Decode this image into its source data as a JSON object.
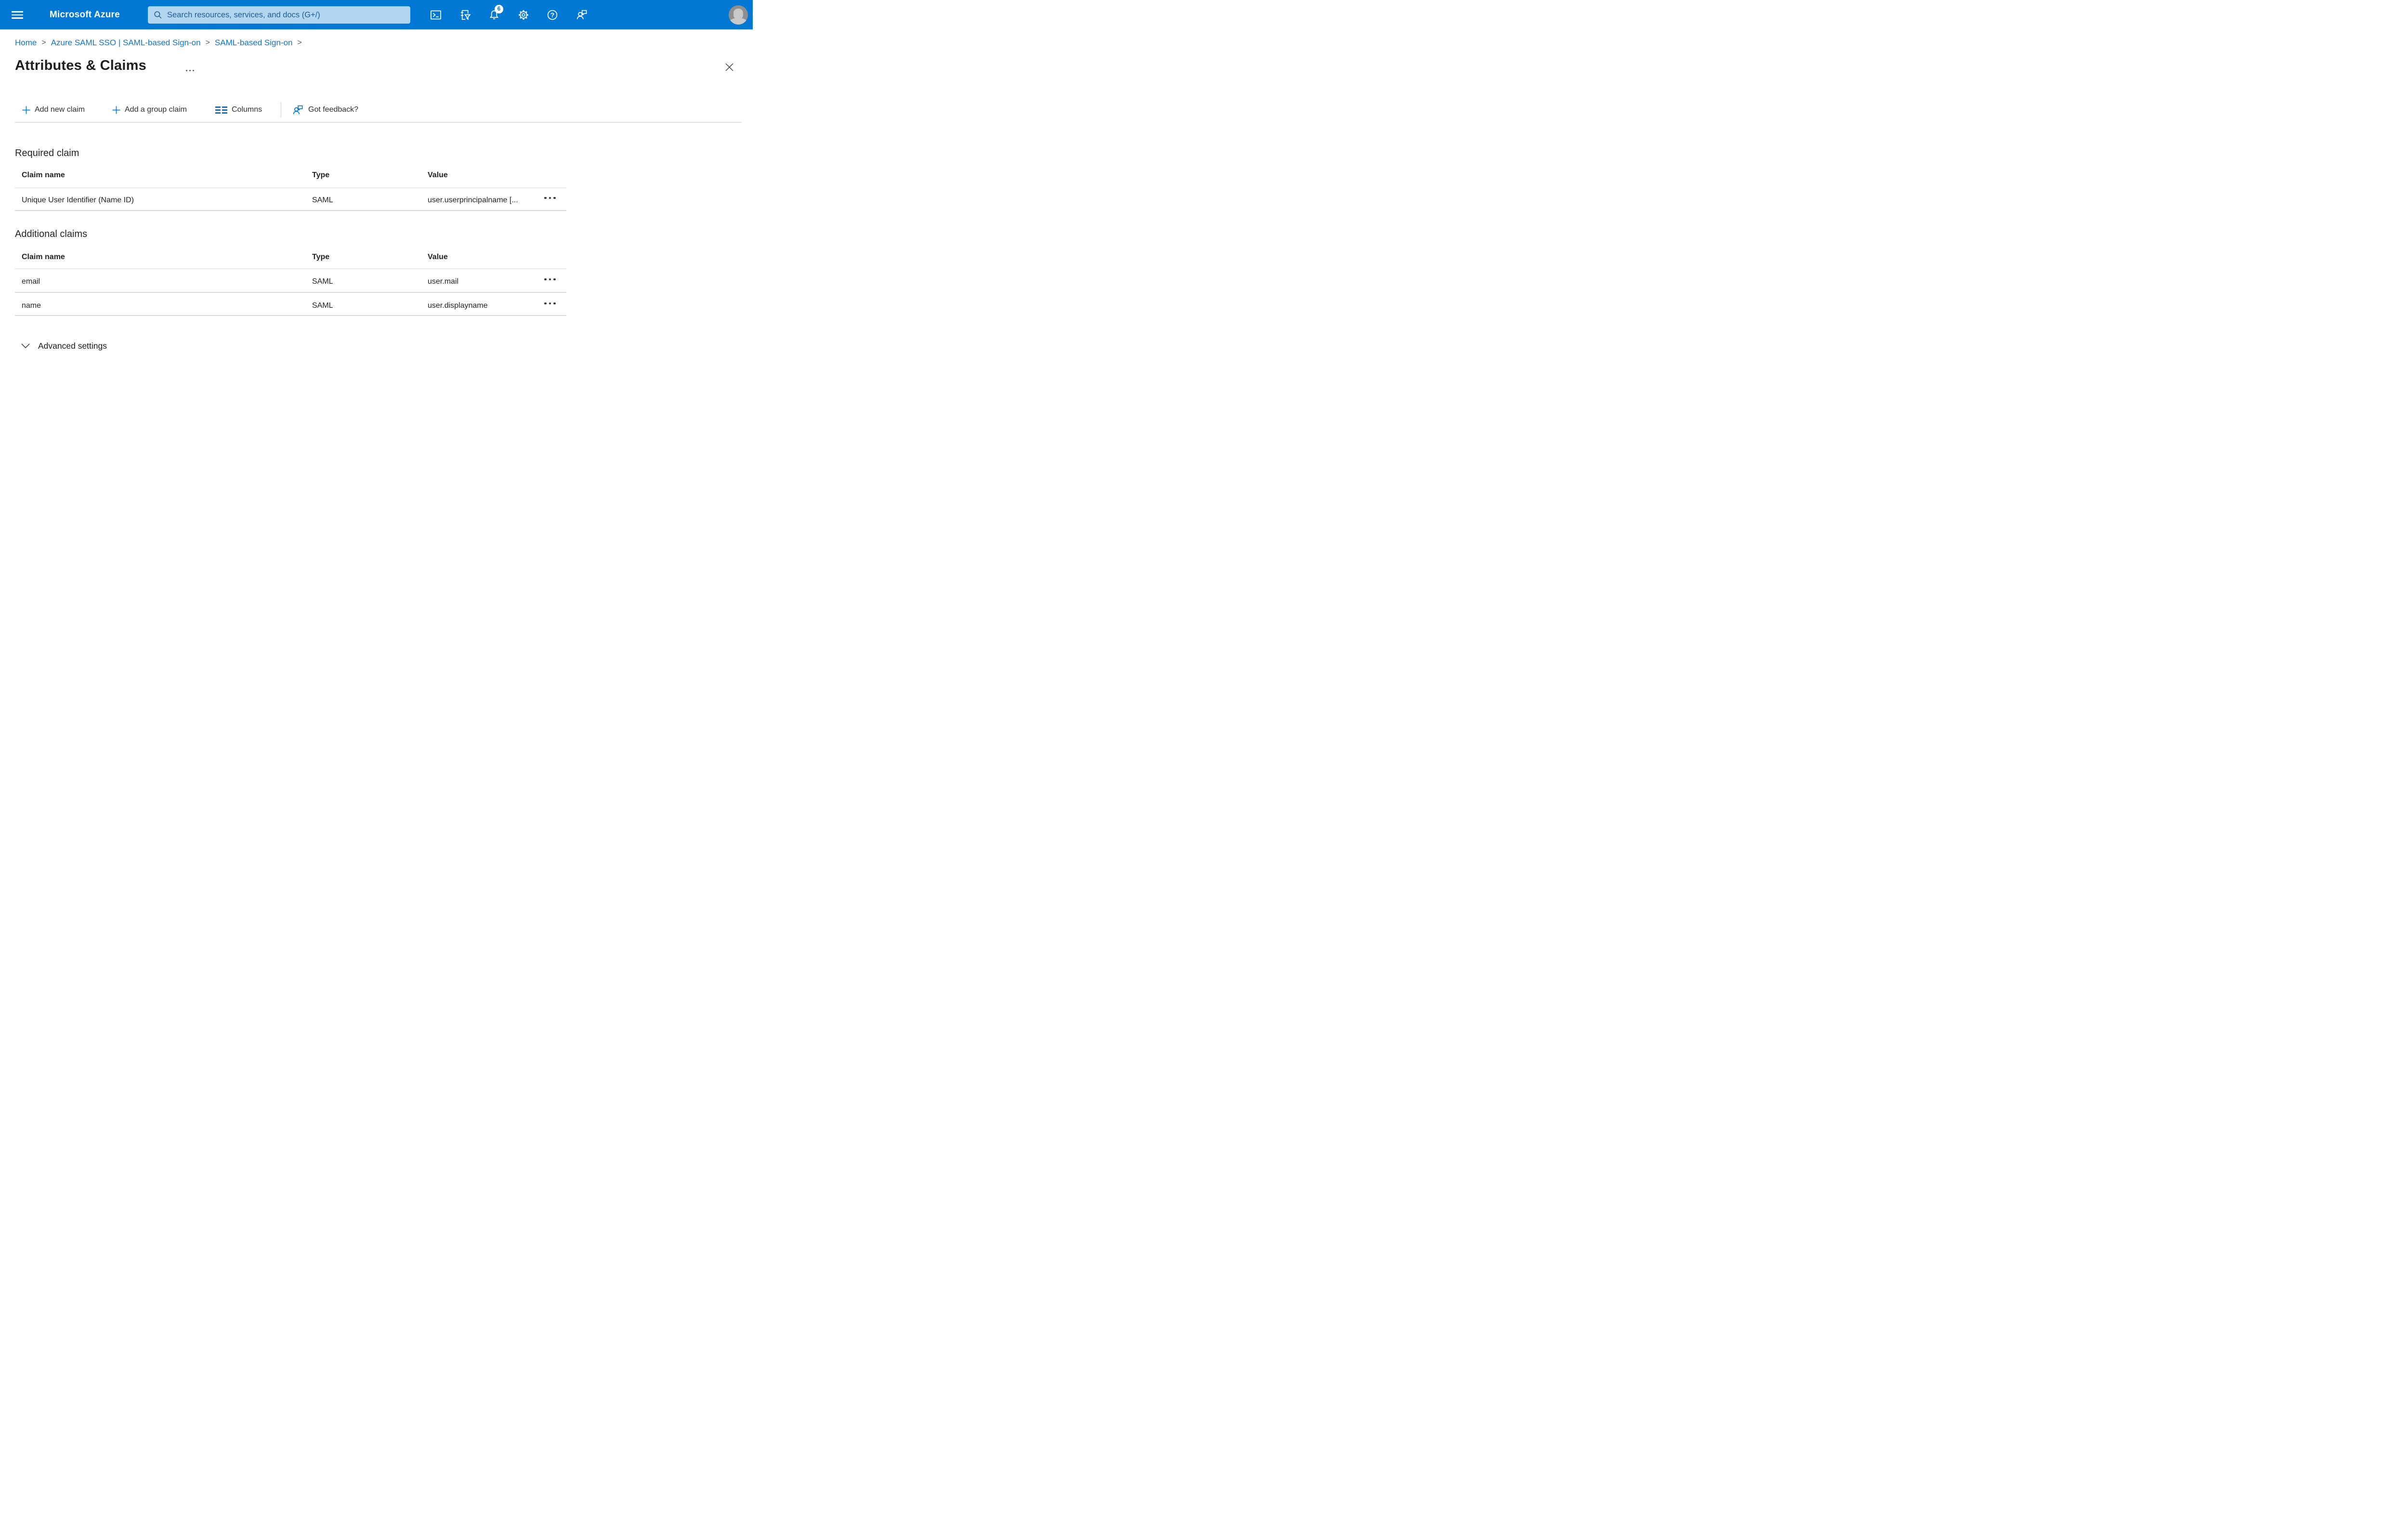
{
  "colors": {
    "header_bg": "#0078d4",
    "search_bg": "#b3d6f0",
    "search_text": "#1d5d97",
    "link": "#0b76d1",
    "accent": "#0078d4",
    "text": "#252423"
  },
  "topbar": {
    "brand": "Microsoft Azure",
    "search_placeholder": "Search resources, services, and docs (G+/)",
    "notification_count": "6",
    "help_glyph": "?"
  },
  "breadcrumb": {
    "separator": ">",
    "items": [
      {
        "label": "Home"
      },
      {
        "label": "Azure SAML SSO | SAML-based Sign-on"
      },
      {
        "label": "SAML-based Sign-on"
      }
    ]
  },
  "page": {
    "title": "Attributes & Claims"
  },
  "toolbar": {
    "add_new_claim": "Add new claim",
    "add_group_claim": "Add a group claim",
    "columns": "Columns",
    "got_feedback": "Got feedback?"
  },
  "required_claim": {
    "heading": "Required claim",
    "headers": {
      "claim": "Claim name",
      "type": "Type",
      "value": "Value"
    },
    "rows": [
      {
        "claim": "Unique User Identifier (Name ID)",
        "type": "SAML",
        "value": "user.userprincipalname [..."
      }
    ]
  },
  "additional_claims": {
    "heading": "Additional claims",
    "headers": {
      "claim": "Claim name",
      "type": "Type",
      "value": "Value"
    },
    "rows": [
      {
        "claim": "email",
        "type": "SAML",
        "value": "user.mail"
      },
      {
        "claim": "name",
        "type": "SAML",
        "value": "user.displayname"
      }
    ]
  },
  "advanced": {
    "label": "Advanced settings"
  }
}
